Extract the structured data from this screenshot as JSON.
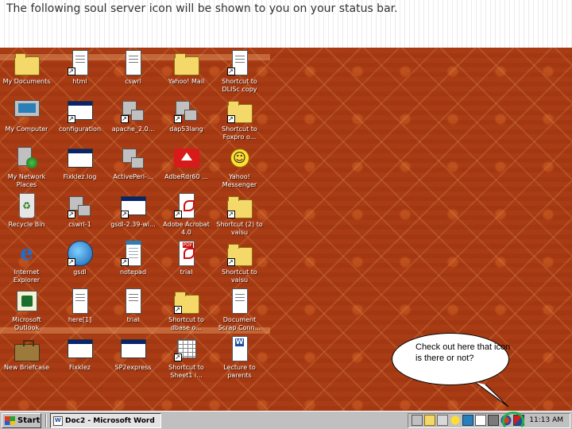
{
  "header": {
    "caption": "The following soul server icon will be shown to you on your status bar."
  },
  "desktop": {
    "icons": [
      {
        "label": "My Documents",
        "icon": "folder-documents-icon"
      },
      {
        "label": "html",
        "icon": "shortcut-document-icon"
      },
      {
        "label": "cswrl",
        "icon": "document-icon"
      },
      {
        "label": "Yahoo! Mail",
        "icon": "yahoo-mail-folder-icon"
      },
      {
        "label": "Shortcut to DLISc copy",
        "icon": "shortcut-document-icon"
      },
      {
        "label": "My Computer",
        "icon": "computer-icon"
      },
      {
        "label": "configuration",
        "icon": "window-shortcut-icon"
      },
      {
        "label": "apache_2.0...",
        "icon": "network-computer-icon"
      },
      {
        "label": "dap53lang",
        "icon": "network-computer-icon"
      },
      {
        "label": "Shortcut to Foxpro o...",
        "icon": "shortcut-folder-icon"
      },
      {
        "label": "My Network Places",
        "icon": "network-places-icon"
      },
      {
        "label": "Fixklez.log",
        "icon": "window-log-icon"
      },
      {
        "label": "ActivePerl-...",
        "icon": "installer-icon"
      },
      {
        "label": "AdbeRdr60 ...",
        "icon": "adobe-reader-icon"
      },
      {
        "label": "Yahoo! Messenger",
        "icon": "yahoo-messenger-icon"
      },
      {
        "label": "Recycle Bin",
        "icon": "recycle-bin-icon"
      },
      {
        "label": "cswrl-1",
        "icon": "network-computer-icon"
      },
      {
        "label": "gsdl-2.39-wi...",
        "icon": "window-shortcut-icon"
      },
      {
        "label": "Adobe Acrobat 4.0",
        "icon": "pdf-shortcut-icon"
      },
      {
        "label": "Shortcut (2) to vaisu",
        "icon": "shortcut-folder-icon"
      },
      {
        "label": "Internet Explorer",
        "icon": "internet-explorer-icon"
      },
      {
        "label": "gsdl",
        "icon": "globe-shortcut-icon"
      },
      {
        "label": "notepad",
        "icon": "notepad-icon"
      },
      {
        "label": "trial",
        "icon": "pdf-document-icon"
      },
      {
        "label": "Shortcut to vaisu",
        "icon": "shortcut-folder-icon"
      },
      {
        "label": "Microsoft Outlook",
        "icon": "outlook-icon"
      },
      {
        "label": "here[1]",
        "icon": "image-document-icon"
      },
      {
        "label": "trial",
        "icon": "document-icon"
      },
      {
        "label": "Shortcut to dbase o...",
        "icon": "shortcut-folder-icon"
      },
      {
        "label": "Document Scrap Conn...",
        "icon": "scrap-document-icon"
      },
      {
        "label": "New Briefcase",
        "icon": "briefcase-icon"
      },
      {
        "label": "Fixklez",
        "icon": "window-app-icon"
      },
      {
        "label": "SP2express",
        "icon": "window-app-icon"
      },
      {
        "label": "Shortcut to Sheet1 i...",
        "icon": "excel-sheet-icon"
      },
      {
        "label": "Lecture to parents",
        "icon": "word-document-icon"
      }
    ]
  },
  "callout": {
    "text": "Check out  here that icon is there or not?"
  },
  "taskbar": {
    "start_label": "Start",
    "tasks": [
      {
        "label": "Doc2 - Microsoft Word",
        "icon": "word-icon"
      }
    ],
    "tray_icons": [
      "network-tray-icon",
      "folder-tray-icon",
      "printer-tray-icon",
      "weather-tray-icon",
      "monitor-tray-icon",
      "document-tray-icon",
      "speaker-tray-icon",
      "antivirus-tray-icon",
      "soul-server-icon"
    ],
    "clock": "11:13 AM"
  },
  "colors": {
    "wallpaper": "#a93c14",
    "taskbar": "#c0c0c0",
    "highlight_ring": "#22b14c"
  }
}
